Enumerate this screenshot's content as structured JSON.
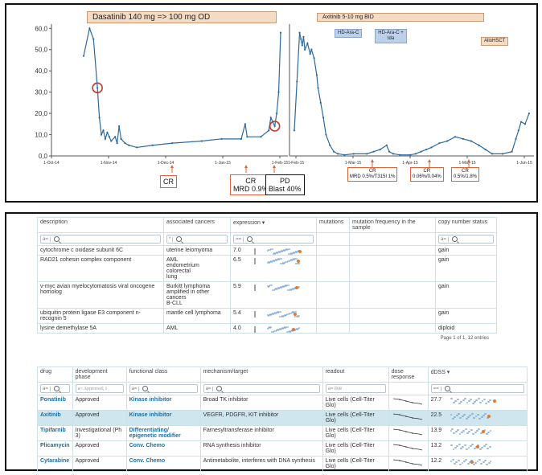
{
  "chart_data": {
    "type": "line",
    "left_panel": {
      "x_ticks": [
        "1-Oct-14",
        "1-Nov-14",
        "1-Dec-14",
        "1-Jan-15",
        "1-Feb-15"
      ],
      "y_ticks": [
        "0,0",
        "10,0",
        "20,0",
        "30,0",
        "40,0",
        "50,0",
        "60,0"
      ],
      "ylim": [
        0,
        62
      ],
      "banner": "Dasatinib 140 mg => 100 mg OD",
      "series": [
        {
          "values": [
            [
              0,
              47
            ],
            [
              3,
              60
            ],
            [
              5,
              55
            ],
            [
              7,
              32
            ],
            [
              8,
              18
            ],
            [
              9,
              10
            ],
            [
              10,
              12
            ],
            [
              11,
              8
            ],
            [
              12,
              11
            ],
            [
              13,
              9
            ],
            [
              14,
              7
            ],
            [
              16,
              9
            ],
            [
              17,
              6
            ],
            [
              18,
              14
            ],
            [
              19,
              8
            ],
            [
              21,
              6
            ],
            [
              23,
              5
            ],
            [
              27,
              4
            ],
            [
              35,
              5
            ],
            [
              45,
              6
            ],
            [
              60,
              7
            ],
            [
              70,
              8
            ],
            [
              80,
              8
            ],
            [
              82,
              15
            ],
            [
              83,
              9
            ],
            [
              90,
              9
            ],
            [
              94,
              12
            ],
            [
              95,
              18
            ],
            [
              96,
              16
            ],
            [
              97,
              14
            ],
            [
              98,
              20
            ],
            [
              99,
              30
            ],
            [
              100,
              58
            ]
          ]
        }
      ],
      "annotations": [
        {
          "text": "CR"
        },
        {
          "text": [
            "CR",
            "MRD 0.9%"
          ]
        },
        {
          "text": [
            "PD",
            "Blast 40%"
          ]
        }
      ]
    },
    "right_panel": {
      "x_ticks": [
        "1-Feb-15",
        "1-Mar-15",
        "1-Apr-15",
        "1-May-15",
        "1-Jun-15"
      ],
      "banner": "Axitinib 5-10 mg BID",
      "chips": [
        "HD-Ara-C",
        "HD-Ara-C + Ida",
        "AlloHSCT"
      ],
      "series": [
        {
          "values": [
            [
              0,
              12
            ],
            [
              2,
              35
            ],
            [
              4,
              58
            ],
            [
              5,
              55
            ],
            [
              6,
              52
            ],
            [
              7,
              56
            ],
            [
              8,
              50
            ],
            [
              10,
              53
            ],
            [
              12,
              48
            ],
            [
              13,
              50
            ],
            [
              15,
              46
            ],
            [
              17,
              38
            ],
            [
              18,
              32
            ],
            [
              20,
              25
            ],
            [
              22,
              18
            ],
            [
              24,
              10
            ],
            [
              27,
              5
            ],
            [
              30,
              2
            ],
            [
              33,
              1
            ],
            [
              38,
              0.5
            ],
            [
              45,
              1
            ],
            [
              55,
              1
            ],
            [
              60,
              2
            ],
            [
              65,
              3
            ],
            [
              70,
              5
            ],
            [
              72,
              2
            ],
            [
              75,
              1
            ],
            [
              80,
              0.5
            ],
            [
              88,
              0.5
            ],
            [
              92,
              1
            ],
            [
              96,
              2
            ],
            [
              100,
              3
            ],
            [
              104,
              4
            ],
            [
              110,
              6
            ],
            [
              116,
              7
            ],
            [
              122,
              9
            ],
            [
              128,
              8
            ],
            [
              134,
              7
            ],
            [
              140,
              5
            ],
            [
              145,
              3
            ],
            [
              150,
              1
            ],
            [
              158,
              1
            ],
            [
              165,
              2
            ],
            [
              168,
              8
            ],
            [
              170,
              12
            ],
            [
              172,
              16
            ],
            [
              175,
              15
            ],
            [
              178,
              20
            ]
          ]
        }
      ],
      "annotations": [
        {
          "text": [
            "CR",
            "MRD 0.5%/T315I 1%"
          ]
        },
        {
          "text": [
            "CR",
            "0.06%/0.04%"
          ]
        },
        {
          "text": [
            "CR",
            "0.5%/1.8%"
          ]
        }
      ]
    }
  },
  "gene_table": {
    "columns": [
      "description",
      "associated cancers",
      "expression ▾",
      "mutations",
      "mutation frequency in the sample",
      "copy number status"
    ],
    "filters": {
      "description": "a=",
      "cancers": "*",
      "expression": "==",
      "copy_number": "a="
    },
    "rows": [
      {
        "description": "cytochrome c oxidase subunit 6C",
        "cancers": "uterine leiomyoma",
        "expression": "7.0",
        "mutations": "",
        "mut_freq": "",
        "copy_number": "gain"
      },
      {
        "description": "RAD21 cohesin complex component",
        "cancers": "AML\nendometrium\ncolorectal\nlung",
        "expression": "6.5",
        "mutations": "",
        "mut_freq": "",
        "copy_number": "gain"
      },
      {
        "description": "v-myc avian myelocytomatosis viral oncogene homolog",
        "cancers": "Burkitt lymphoma\namplified in other cancers\nB-CLL",
        "expression": "5.9",
        "mutations": "",
        "mut_freq": "",
        "copy_number": "gain"
      },
      {
        "description": "ubiquitin protein ligase E3 component n-recognin 5",
        "cancers": "mantle cell lymphoma",
        "expression": "5.4",
        "mutations": "",
        "mut_freq": "",
        "copy_number": "gain"
      },
      {
        "description": "lysine demethylase 5A",
        "cancers": "AML",
        "expression": "4.0",
        "mutations": "",
        "mut_freq": "",
        "copy_number": "diploid"
      }
    ],
    "footer": "Page 1 of 1, 12 entries"
  },
  "drug_table": {
    "columns": [
      "drug",
      "development phase",
      "functional class",
      "mechanism/target",
      "readout",
      "dose response",
      "dDSS ▾"
    ],
    "filters": {
      "drug": "a=",
      "phase": "a= Approved; I",
      "class": "a=",
      "mechanism": "a=",
      "readout": "a= live",
      "dss": "=="
    },
    "rows": [
      {
        "drug": "Ponatinib",
        "phase": "Approved",
        "class": "Kinase inhibitor",
        "mechanism": "Broad TK inhibitor",
        "readout": "Live cells (Cell-Titer Glo)",
        "dss": "27.7"
      },
      {
        "drug": "Axitinib",
        "phase": "Approved",
        "class": "Kinase inhibitor",
        "mechanism": "VEGFR, PDGFR, KIT inhibitor",
        "readout": "Live cells (Cell-Titer Glo)",
        "dss": "22.5"
      },
      {
        "drug": "Tipifarnib",
        "phase": "Investigational (Ph 3)",
        "class": "Differentiating/ epigenetic modifier",
        "mechanism": "Farnesyltransferase inhibitor",
        "readout": "Live cells (Cell-Titer Glo)",
        "dss": "13.9"
      },
      {
        "drug": "Plicamycin",
        "phase": "Approved",
        "class": "Conv. Chemo",
        "mechanism": "RNA synthesis inhibitor",
        "readout": "Live cells (Cell-Titer Glo)",
        "dss": "13.2"
      },
      {
        "drug": "Cytarabine",
        "phase": "Approved",
        "class": "Conv. Chemo",
        "mechanism": "Antimetabolite, interferes with DNA synthesis",
        "readout": "Live cells (Cell-Titer Glo)",
        "dss": "12.2"
      }
    ]
  }
}
